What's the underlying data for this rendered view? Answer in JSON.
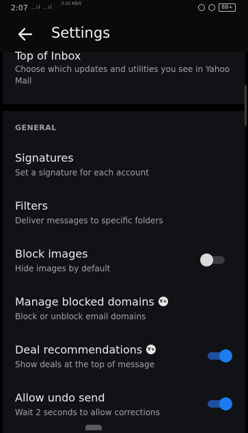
{
  "status_bar": {
    "time": "2:07",
    "signal": "..ıl ..ıl",
    "net": "0.25 KB/S",
    "battery": "88+"
  },
  "header": {
    "title": "Settings"
  },
  "top_of_inbox": {
    "title": "Top of Inbox",
    "subtitle": "Choose which updates and utilities you see in Yahoo Mail"
  },
  "section": {
    "label": "GENERAL"
  },
  "items": [
    {
      "title": "Signatures",
      "subtitle": "Set a signature for each account"
    },
    {
      "title": "Filters",
      "subtitle": "Deliver messages to specific folders"
    },
    {
      "title": "Block images",
      "subtitle": "Hide images by default",
      "toggle_on": false
    },
    {
      "title": "Manage blocked domains",
      "subtitle": "Block or unblock email domains",
      "badge": "Y+"
    },
    {
      "title": "Deal recommendations",
      "subtitle": "Show deals at the top of message",
      "badge": "Y+",
      "toggle_on": true
    },
    {
      "title": "Allow undo send",
      "subtitle": "Wait 2 seconds to allow corrections",
      "toggle_on": true
    }
  ],
  "colors": {
    "accent": "#1e7bf0",
    "background": "#000000",
    "card": "#111216"
  }
}
